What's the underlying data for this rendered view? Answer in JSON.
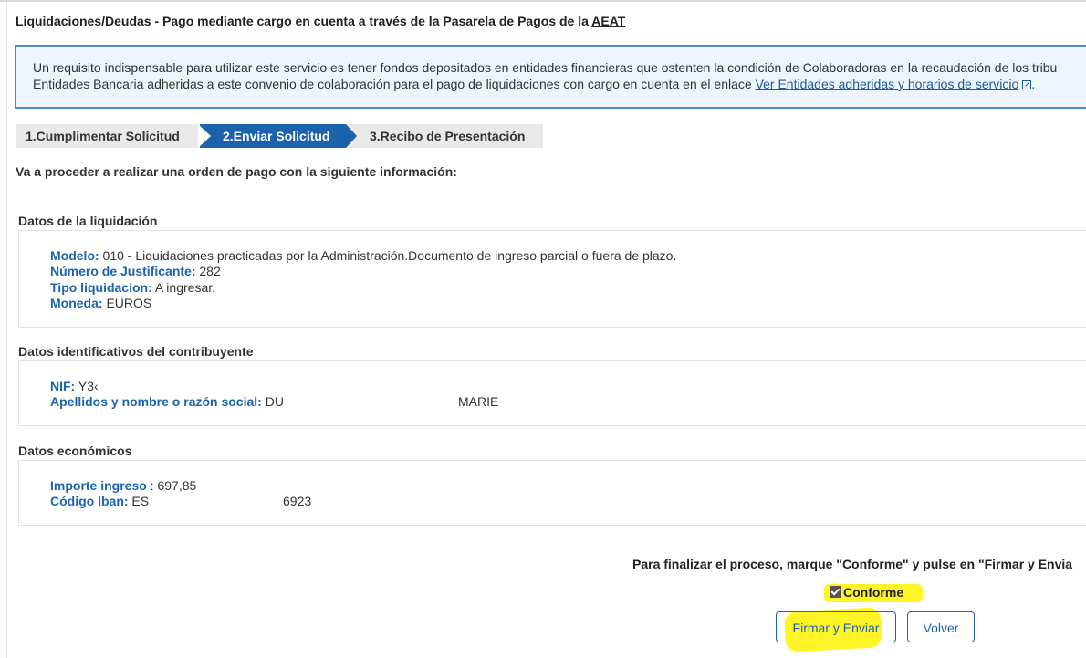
{
  "header": {
    "title_prefix": "Liquidaciones/Deudas - Pago mediante cargo en cuenta a través de la Pasarela de Pagos de la ",
    "title_link": "AEAT"
  },
  "info": {
    "line1": "Un requisito indispensable para utilizar este servicio es tener fondos depositados en entidades financieras que ostenten la condición de Colaboradoras en la recaudación de los tribu",
    "line2_prefix": "Entidades Bancaria adheridas a este convenio de colaboración para el pago de liquidaciones con cargo en cuenta en el enlace ",
    "link": "Ver Entidades adheridas y horarios de servicio",
    "line2_suffix": "."
  },
  "steps": [
    {
      "label": "1.Cumplimentar Solicitud",
      "active": false
    },
    {
      "label": "2.Enviar Solicitud",
      "active": true
    },
    {
      "label": "3.Recibo de Presentación",
      "active": false
    }
  ],
  "intro": "Va a proceder a realizar una orden de pago con la siguiente información:",
  "liquidacion": {
    "title": "Datos de la liquidación",
    "modelo_label": "Modelo:",
    "modelo_value": " 010 - Liquidaciones practicadas por la Administración.Documento de ingreso parcial o fuera de plazo.",
    "justificante_label": "Número de Justificante:",
    "justificante_value": " 282",
    "tipo_label": "Tipo liquidacion:",
    "tipo_value": " A ingresar.",
    "moneda_label": "Moneda:",
    "moneda_value": " EUROS"
  },
  "contribuyente": {
    "title": "Datos identificativos del contribuyente",
    "nif_label": "NIF:",
    "nif_value": " Y3‹",
    "nombre_label": "Apellidos y nombre o razón social:",
    "nombre_value_a": " DU",
    "nombre_value_b": "MARIE"
  },
  "economicos": {
    "title": "Datos económicos",
    "importe_label": "Importe ingreso",
    "importe_value": " : 697,85",
    "iban_label": "Código Iban:",
    "iban_value_a": " ES",
    "iban_value_b": "6923"
  },
  "footer": {
    "instruction": "Para finalizar el proceso, marque \"Conforme\" y pulse en \"Firmar y Envia",
    "conforme_label": "Conforme",
    "conforme_checked": true,
    "sign_button": "Firmar y Enviar",
    "back_button": "Volver",
    "highlight_color": "#fff200",
    "accent_color": "#1b64ad"
  }
}
